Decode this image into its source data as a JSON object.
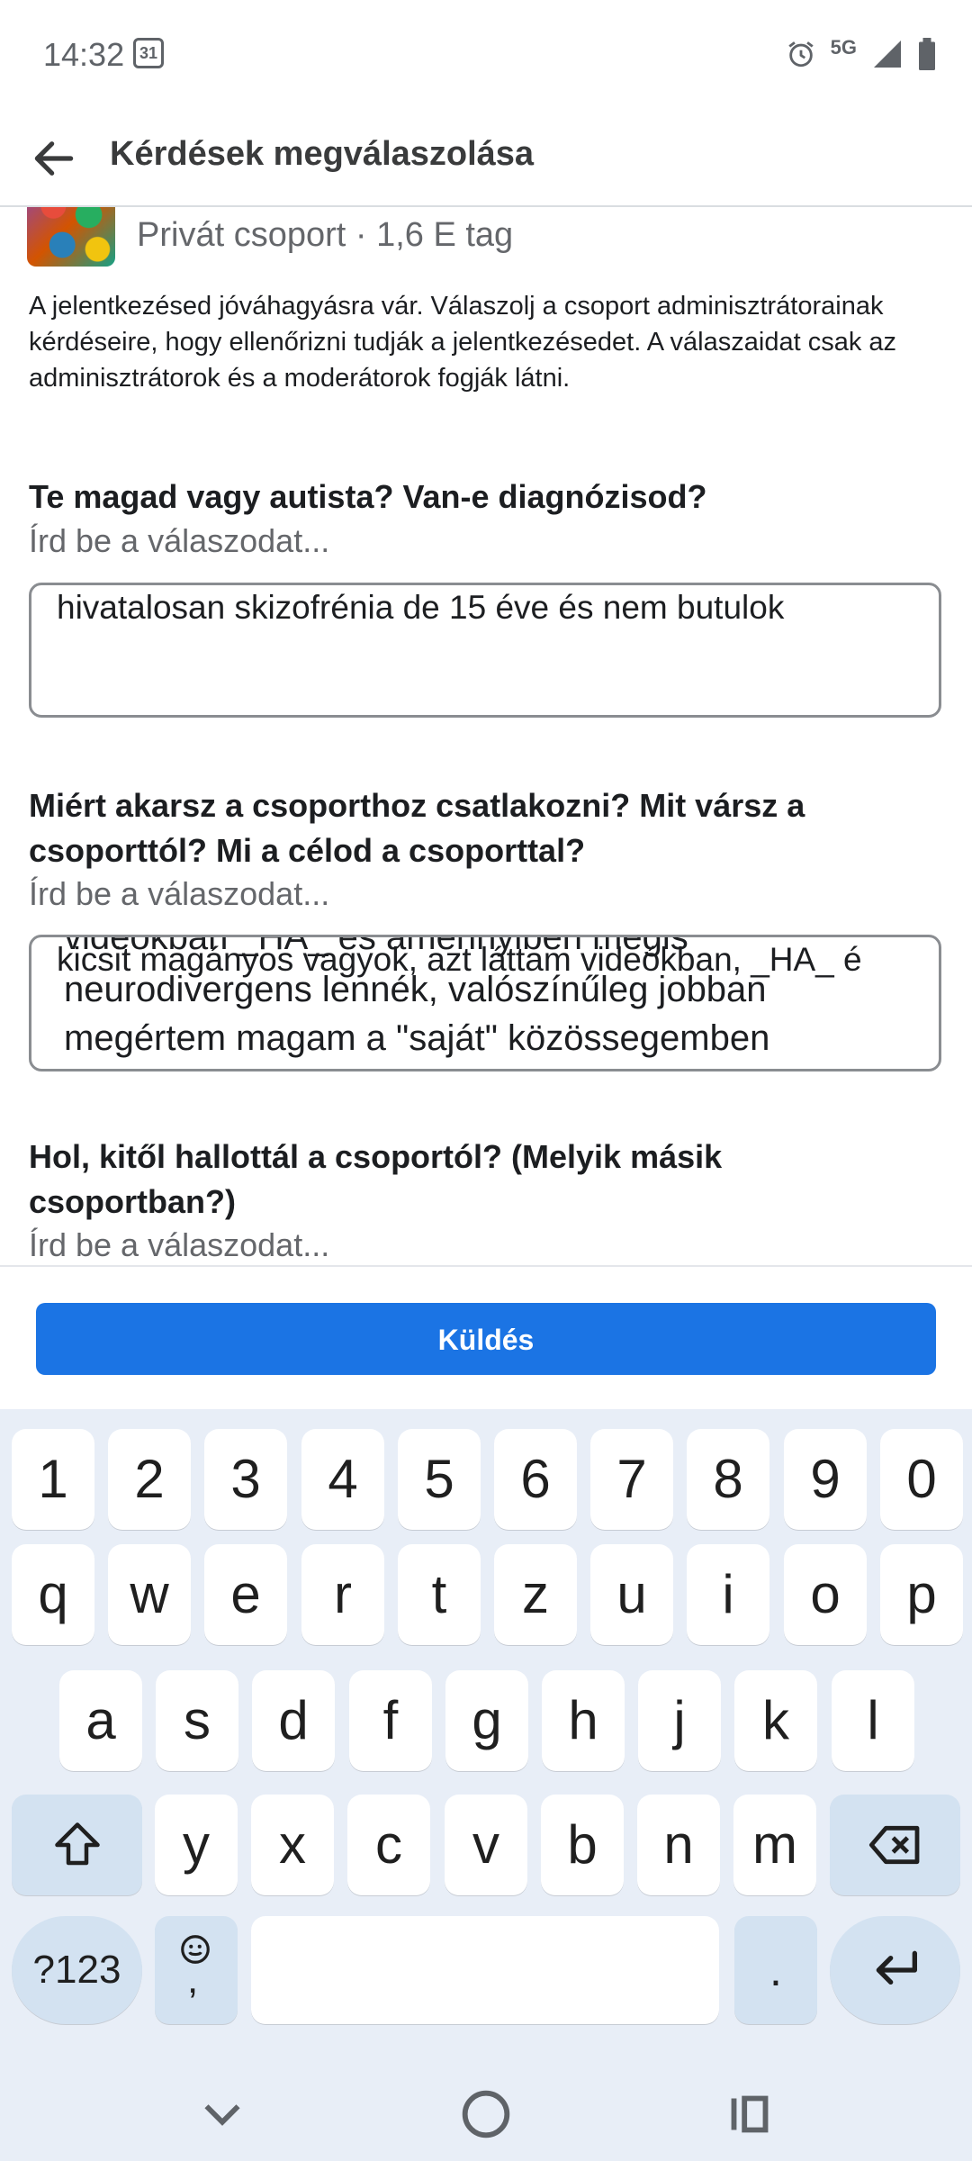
{
  "status_bar": {
    "time": "14:32",
    "calendar_day": "31",
    "network": "5G"
  },
  "header": {
    "title": "Kérdések megválaszolása"
  },
  "group": {
    "meta": "Privát csoport · 1,6 E tag"
  },
  "intro": "A jelentkezésed jóváhagyásra vár. Válaszolj a csoport adminisztrátorainak kérdéseire, hogy ellenőrizni tudják a jelentkezésedet. A válaszaidat csak az adminisztrátorok és a moderátorok fogják látni.",
  "questions": [
    {
      "title": "Te magad vagy autista? Van-e diagnózisod?",
      "placeholder": "Írd be a válaszodat...",
      "answer": "hivatalosan skizofrénia de 15 éve és nem butulok"
    },
    {
      "title": "Miért akarsz a csoporthoz csatlakozni? Mit vársz a csoporttól? Mi a célod a csoporttal?",
      "placeholder": "Írd be a válaszodat...",
      "answer_lines": [
        "videokban _HA_ és amennyiben mégis",
        "kicsit magányos vagyok, azt láttam videókban, _HA_ é",
        "neurodivergens lennék, valószínűleg jobban",
        "megértem magam a \"saját\" közössegemben"
      ]
    },
    {
      "title": "Hol, kitől hallottál a csoportól? (Melyik másik csoportban?)",
      "placeholder": "Írd be a válaszodat..."
    }
  ],
  "send_button": "Küldés",
  "keyboard": {
    "row_numbers": [
      "1",
      "2",
      "3",
      "4",
      "5",
      "6",
      "7",
      "8",
      "9",
      "0"
    ],
    "row1": [
      "q",
      "w",
      "e",
      "r",
      "t",
      "z",
      "u",
      "i",
      "o",
      "p"
    ],
    "row2": [
      "a",
      "s",
      "d",
      "f",
      "g",
      "h",
      "j",
      "k",
      "l"
    ],
    "row3": [
      "y",
      "x",
      "c",
      "v",
      "b",
      "n",
      "m"
    ],
    "symbols_key": "?123",
    "emoji_comma_key": ",",
    "period_key": "."
  }
}
